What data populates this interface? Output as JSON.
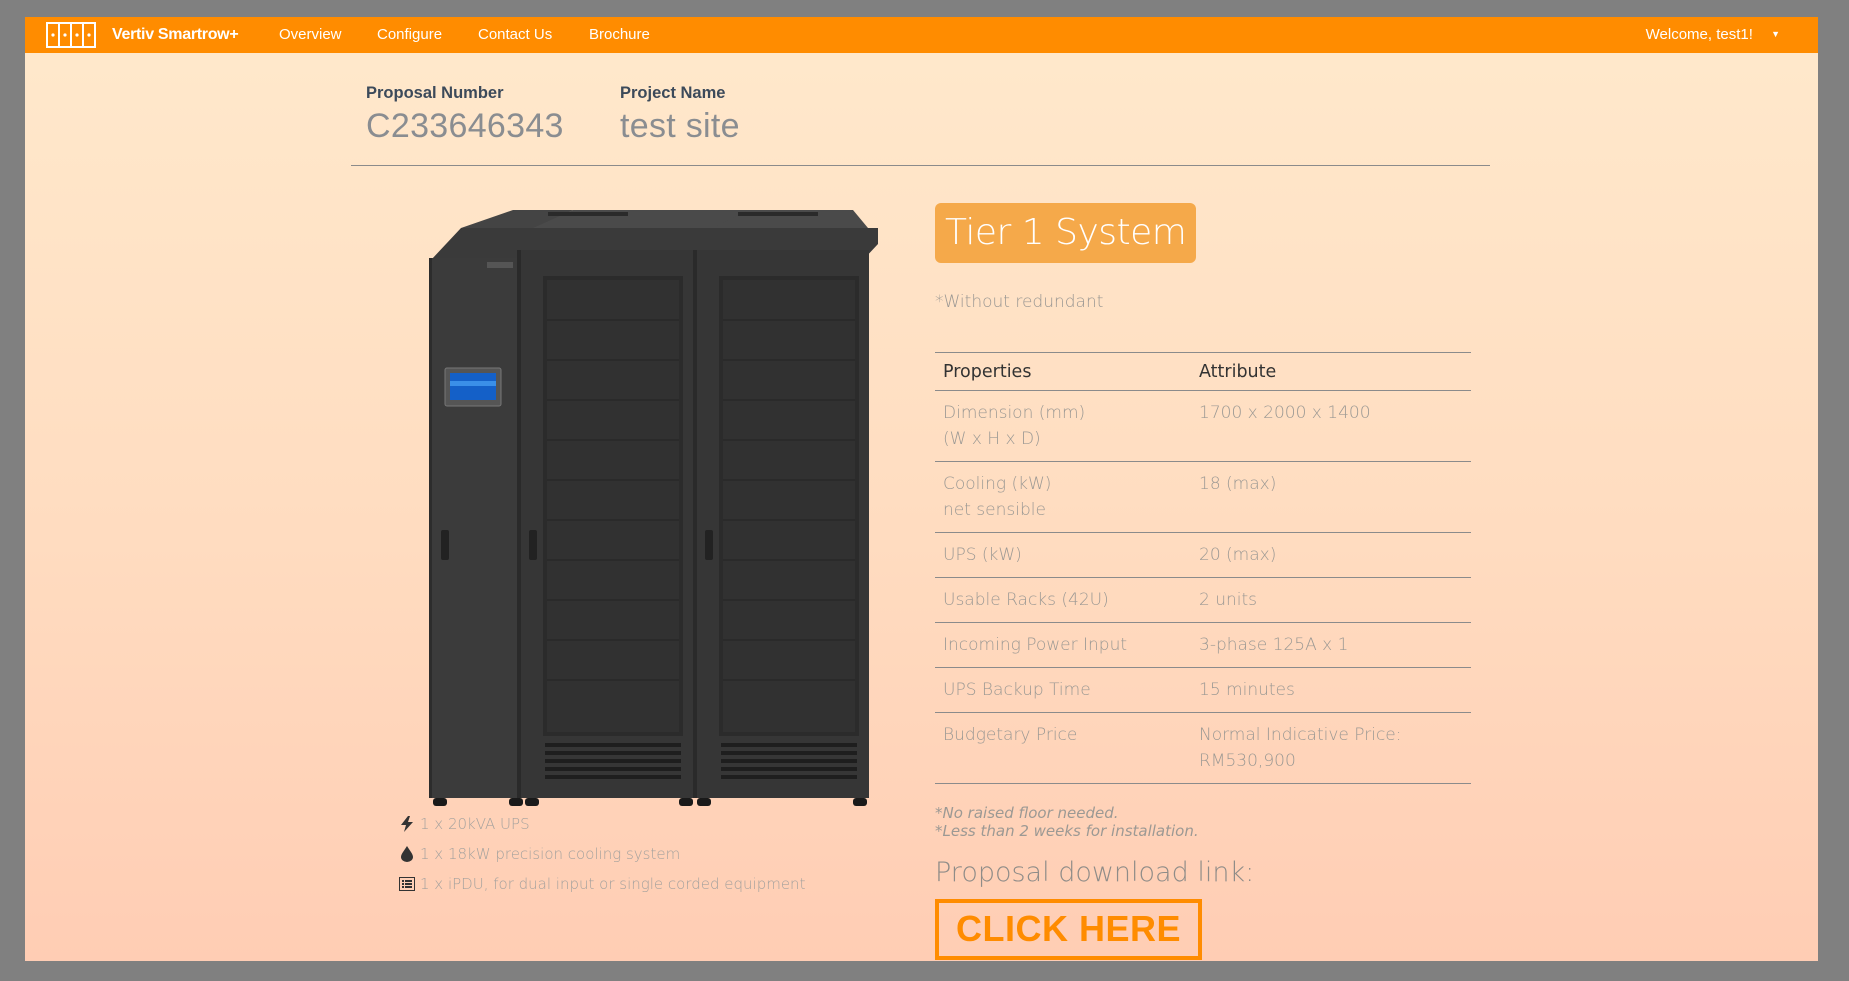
{
  "navbar": {
    "brand": "Vertiv Smartrow+",
    "links": [
      "Overview",
      "Configure",
      "Contact Us",
      "Brochure"
    ],
    "welcome": "Welcome, test1!",
    "accent_color": "#ff8c00",
    "logo_icon": "rack-logo-icon",
    "caret_icon": "caret-down-icon"
  },
  "proposal": {
    "number_label": "Proposal Number",
    "number_value": "C233646343",
    "project_label": "Project Name",
    "project_value": "test site"
  },
  "product": {
    "image_icon": "smartrow-cabinet-image",
    "features": [
      {
        "icon": "bolt-icon",
        "text": "1 x 20kVA UPS"
      },
      {
        "icon": "droplet-icon",
        "text": "1 x 18kW precision cooling system"
      },
      {
        "icon": "list-icon",
        "text": "1 x iPDU, for dual input or single corded equipment"
      }
    ]
  },
  "system": {
    "tier_title": "Tier 1 System",
    "tier_note": "*Without redundant",
    "badge_color": "#f5a94a",
    "table": {
      "headers": [
        "Properties",
        "Attribute"
      ],
      "rows": [
        {
          "property": "Dimension (mm)\n(W x H x D)",
          "attribute": "1700 x 2000 x 1400"
        },
        {
          "property": "Cooling (kW)\nnet sensible",
          "attribute": "18 (max)"
        },
        {
          "property": "UPS (kW)",
          "attribute": "20 (max)"
        },
        {
          "property": "Usable Racks (42U)",
          "attribute": "2 units"
        },
        {
          "property": "Incoming Power Input",
          "attribute": "3-phase 125A x 1"
        },
        {
          "property": "UPS Backup Time",
          "attribute": "15 minutes"
        },
        {
          "property": "Budgetary Price",
          "attribute": "Normal Indicative Price:\nRM530,900"
        }
      ]
    },
    "notes": [
      "*No raised floor needed.",
      "*Less than 2 weeks for installation."
    ],
    "download_label": "Proposal download link:",
    "download_button": "CLICK HERE"
  }
}
